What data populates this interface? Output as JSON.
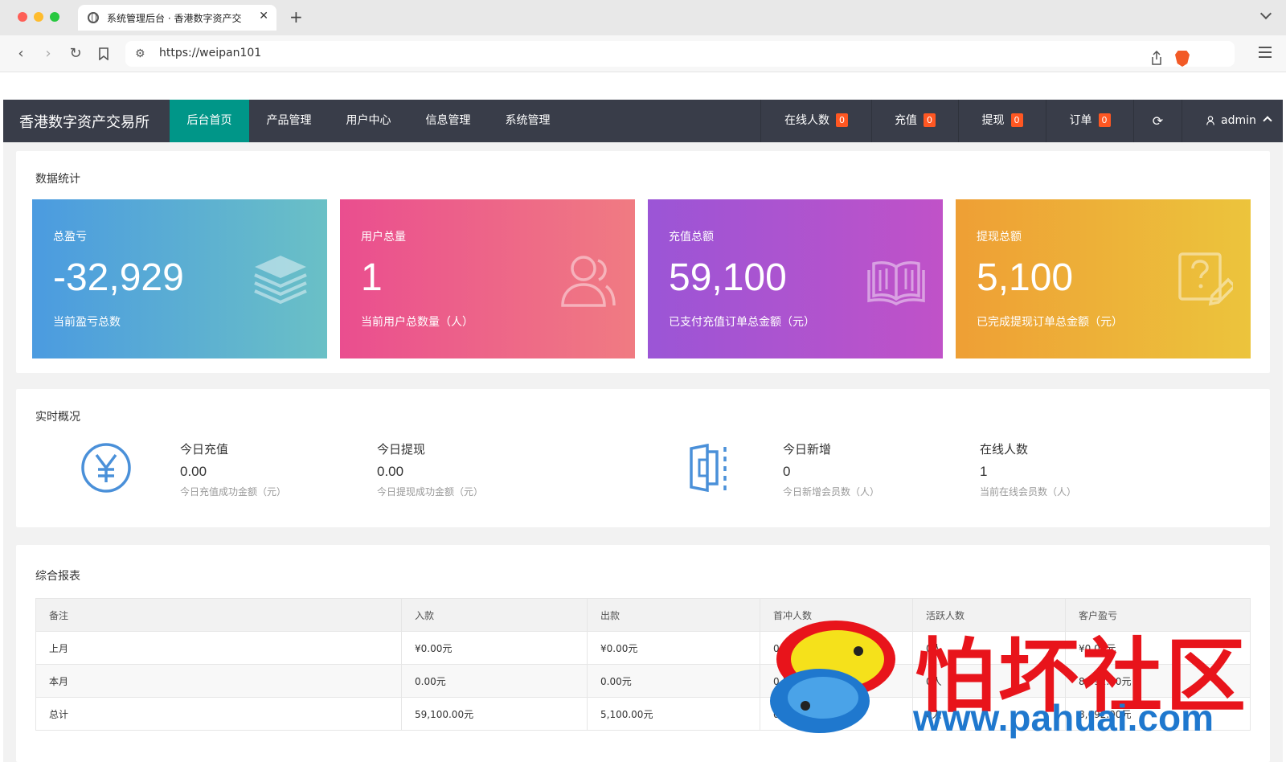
{
  "browser": {
    "tab_title": "系统管理后台 · 香港数字资产交",
    "url": "https://weipan101"
  },
  "nav": {
    "brand": "香港数字资产交易所",
    "menu": [
      {
        "label": "后台首页",
        "active": true
      },
      {
        "label": "产品管理"
      },
      {
        "label": "用户中心"
      },
      {
        "label": "信息管理"
      },
      {
        "label": "系统管理"
      }
    ],
    "stats": [
      {
        "label": "在线人数",
        "count": "0"
      },
      {
        "label": "充值",
        "count": "0"
      },
      {
        "label": "提现",
        "count": "0"
      },
      {
        "label": "订单",
        "count": "0"
      }
    ],
    "user": "admin"
  },
  "overview": {
    "title": "数据统计",
    "tiles": [
      {
        "label": "总盈亏",
        "value": "-32,929",
        "sub": "当前盈亏总数",
        "icon": "layers-icon",
        "colors": [
          "#4b9be0",
          "#6ac0c6"
        ]
      },
      {
        "label": "用户总量",
        "value": "1",
        "sub": "当前用户总数量（人）",
        "icon": "users-icon",
        "colors": [
          "#ea4e8f",
          "#f07b82"
        ]
      },
      {
        "label": "充值总额",
        "value": "59,100",
        "sub": "已支付充值订单总金额（元）",
        "icon": "book-icon",
        "colors": [
          "#9b55d6",
          "#c052c8"
        ]
      },
      {
        "label": "提现总额",
        "value": "5,100",
        "sub": "已完成提现订单总金额（元）",
        "icon": "help-edit-icon",
        "colors": [
          "#ee9f35",
          "#ecc43c"
        ]
      }
    ]
  },
  "realtime": {
    "title": "实时概况",
    "items": [
      {
        "label": "今日充值",
        "value": "0.00",
        "sub": "今日充值成功金额（元）"
      },
      {
        "label": "今日提现",
        "value": "0.00",
        "sub": "今日提现成功金额（元）"
      },
      {
        "label": "今日新增",
        "value": "0",
        "sub": "今日新增会员数（人）"
      },
      {
        "label": "在线人数",
        "value": "1",
        "sub": "当前在线会员数（人）"
      }
    ],
    "icons": [
      "yen-circle-icon",
      "exit-door-icon"
    ]
  },
  "report": {
    "title": "综合报表",
    "columns": [
      "备注",
      "入款",
      "出款",
      "首冲人数",
      "活跃人数",
      "客户盈亏"
    ],
    "rows": [
      [
        "上月",
        "¥0.00元",
        "¥0.00元",
        "0人",
        "0人",
        "¥0.00元"
      ],
      [
        "本月",
        "0.00元",
        "0.00元",
        "0人",
        "0人",
        "8,692.00元"
      ],
      [
        "总计",
        "59,100.00元",
        "5,100.00元",
        "0人",
        "0人",
        "8,692.00元"
      ]
    ]
  },
  "watermark": {
    "text": "怕坏社区",
    "url": "www.pahuai.com"
  },
  "colors": {
    "nav_bg": "#393d49",
    "nav_active": "#009688",
    "badge": "#ff5722",
    "page_bg": "#f2f2f2"
  }
}
